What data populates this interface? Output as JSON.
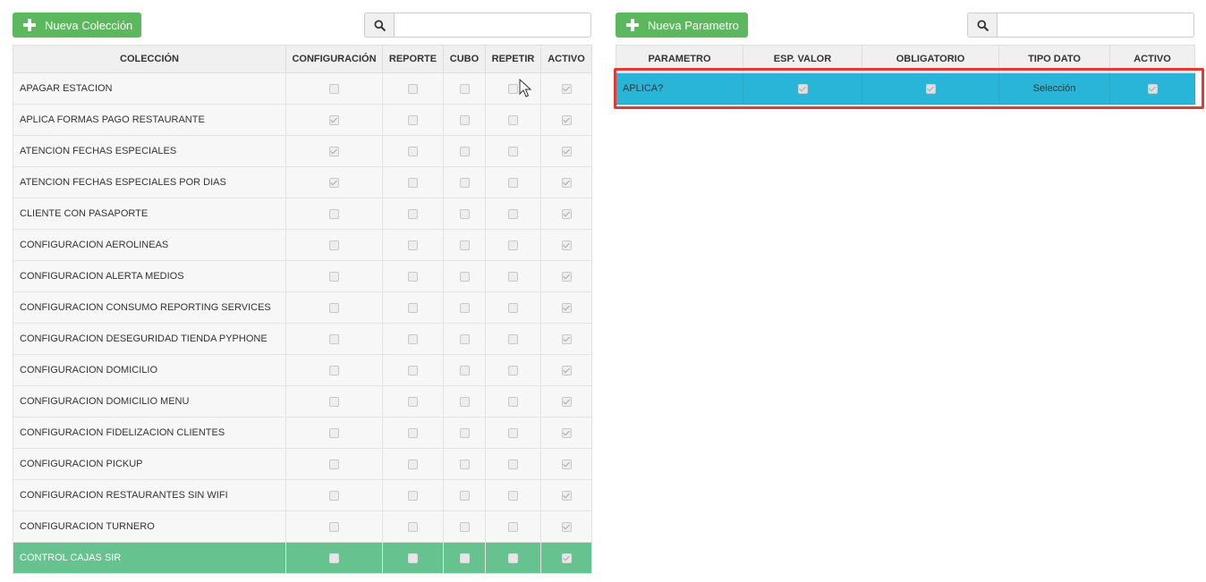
{
  "left": {
    "new_button_label": "Nueva Colección",
    "search": {
      "value": "",
      "placeholder": ""
    },
    "columns": [
      "COLECCIÓN",
      "CONFIGURACIÓN",
      "REPORTE",
      "CUBO",
      "REPETIR",
      "ACTIVO"
    ],
    "rows": [
      {
        "name": "APAGAR ESTACION",
        "config": false,
        "reporte": false,
        "cubo": false,
        "repetir": false,
        "activo": true
      },
      {
        "name": "APLICA FORMAS PAGO RESTAURANTE",
        "config": true,
        "reporte": false,
        "cubo": false,
        "repetir": false,
        "activo": true
      },
      {
        "name": "ATENCION FECHAS ESPECIALES",
        "config": true,
        "reporte": false,
        "cubo": false,
        "repetir": false,
        "activo": true
      },
      {
        "name": "ATENCION FECHAS ESPECIALES POR DIAS",
        "config": true,
        "reporte": false,
        "cubo": false,
        "repetir": false,
        "activo": true
      },
      {
        "name": "CLIENTE CON PASAPORTE",
        "config": false,
        "reporte": false,
        "cubo": false,
        "repetir": false,
        "activo": true
      },
      {
        "name": "CONFIGURACION AEROLINEAS",
        "config": false,
        "reporte": false,
        "cubo": false,
        "repetir": false,
        "activo": true
      },
      {
        "name": "CONFIGURACION ALERTA MEDIOS",
        "config": false,
        "reporte": false,
        "cubo": false,
        "repetir": false,
        "activo": true
      },
      {
        "name": "CONFIGURACION CONSUMO REPORTING SERVICES",
        "config": false,
        "reporte": false,
        "cubo": false,
        "repetir": false,
        "activo": true
      },
      {
        "name": "CONFIGURACION DESEGURIDAD TIENDA PYPHONE",
        "config": false,
        "reporte": false,
        "cubo": false,
        "repetir": false,
        "activo": true
      },
      {
        "name": "CONFIGURACION DOMICILIO",
        "config": false,
        "reporte": false,
        "cubo": false,
        "repetir": false,
        "activo": true
      },
      {
        "name": "CONFIGURACION DOMICILIO MENU",
        "config": false,
        "reporte": false,
        "cubo": false,
        "repetir": false,
        "activo": true
      },
      {
        "name": "CONFIGURACION FIDELIZACION CLIENTES",
        "config": false,
        "reporte": false,
        "cubo": false,
        "repetir": false,
        "activo": true
      },
      {
        "name": "CONFIGURACION PICKUP",
        "config": false,
        "reporte": false,
        "cubo": false,
        "repetir": false,
        "activo": true
      },
      {
        "name": "CONFIGURACION RESTAURANTES SIN WIFI",
        "config": false,
        "reporte": false,
        "cubo": false,
        "repetir": false,
        "activo": true
      },
      {
        "name": "CONFIGURACION TURNERO",
        "config": false,
        "reporte": false,
        "cubo": false,
        "repetir": false,
        "activo": true
      },
      {
        "name": "CONTROL CAJAS SIR",
        "config": false,
        "reporte": false,
        "cubo": false,
        "repetir": false,
        "activo": true,
        "selected": true
      }
    ]
  },
  "right": {
    "new_button_label": "Nueva Parametro",
    "search": {
      "value": "",
      "placeholder": ""
    },
    "columns": [
      "PARAMETRO",
      "ESP. VALOR",
      "OBLIGATORIO",
      "TIPO DATO",
      "ACTIVO"
    ],
    "rows": [
      {
        "parametro": "APLICA?",
        "esp_valor": true,
        "obligatorio": true,
        "tipo_dato": "Selección",
        "activo": true,
        "selected": true
      }
    ]
  },
  "colors": {
    "green_button": "#5cb85c",
    "selected_green": "#66c28e",
    "selected_blue": "#29b5d7",
    "highlight_box": "#e53935"
  }
}
